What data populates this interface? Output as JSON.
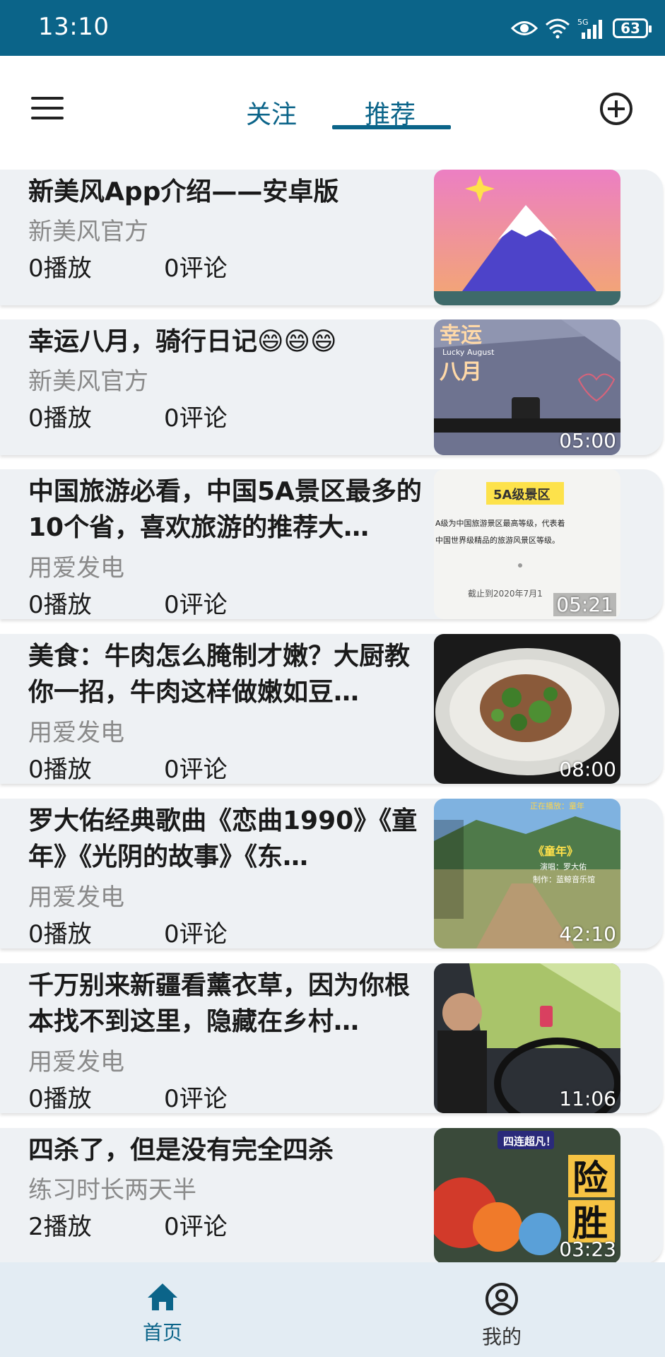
{
  "status_bar": {
    "time": "13:10",
    "battery": "63",
    "network": "5G"
  },
  "header": {
    "tabs": [
      {
        "label": "关注",
        "active": false
      },
      {
        "label": "推荐",
        "active": true
      }
    ]
  },
  "feed": [
    {
      "title": "新美风App介绍——安卓版",
      "author": "新美风官方",
      "plays": "0播放",
      "comments": "0评论",
      "duration": ""
    },
    {
      "title": "幸运八月，骑行日记😄😄😄",
      "author": "新美风官方",
      "plays": "0播放",
      "comments": "0评论",
      "duration": "05:00"
    },
    {
      "title": "中国旅游必看，中国5A景区最多的10个省，喜欢旅游的推荐大…",
      "author": "用爱发电",
      "plays": "0播放",
      "comments": "0评论",
      "duration": "05:21"
    },
    {
      "title": "美食：牛肉怎么腌制才嫩？大厨教你一招，牛肉这样做嫩如豆…",
      "author": "用爱发电",
      "plays": "0播放",
      "comments": "0评论",
      "duration": "08:00"
    },
    {
      "title": "罗大佑经典歌曲《恋曲1990》《童年》《光阴的故事》《东…",
      "author": "用爱发电",
      "plays": "0播放",
      "comments": "0评论",
      "duration": "42:10"
    },
    {
      "title": "千万别来新疆看薰衣草，因为你根本找不到这里，隐藏在乡村…",
      "author": "用爱发电",
      "plays": "0播放",
      "comments": "0评论",
      "duration": "11:06"
    },
    {
      "title": "四杀了，但是没有完全四杀",
      "author": "练习时长两天半",
      "plays": "2播放",
      "comments": "0评论",
      "duration": "03:23"
    }
  ],
  "thumb_text": {
    "t2_line1": "幸运",
    "t2_line2": "Lucky August",
    "t2_line3": "八月",
    "t3_title": "5A级景区",
    "t3_line1": "A级为中国旅游景区最高等级，代表着",
    "t3_line2": "中国世界级精品的旅游风景区等级。",
    "t3_date": "截止到2020年7月1",
    "t5_top": "正在播放：童年",
    "t5_song": "《童年》",
    "t5_singer": "演唱：罗大佑",
    "t5_maker": "制作：蓝鲸音乐馆",
    "t7_top": "四连超凡！",
    "t7_big1": "险",
    "t7_big2": "胜"
  },
  "bottom_nav": [
    {
      "label": "首页",
      "icon": "home-icon",
      "active": true
    },
    {
      "label": "我的",
      "icon": "profile-icon",
      "active": false
    }
  ],
  "colors": {
    "primary": "#0b6489",
    "card_bg": "#eef1f4",
    "nav_bg": "#e3ecf3",
    "secondary_text": "#8a8a8a"
  }
}
